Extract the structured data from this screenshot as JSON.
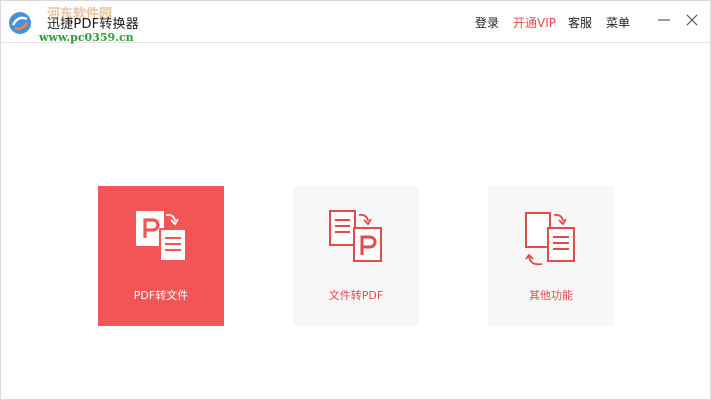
{
  "app": {
    "title": "迅捷PDF转换器",
    "watermark": "河东软件园",
    "watermark_url": "www.pc0359.cn"
  },
  "menu": {
    "login": "登录",
    "vip": "开通VIP",
    "service": "客服",
    "menu": "菜单"
  },
  "cards": [
    {
      "label": "PDF转文件",
      "icon": "pdf-to-file-icon",
      "active": true
    },
    {
      "label": "文件转PDF",
      "icon": "file-to-pdf-icon",
      "active": false
    },
    {
      "label": "其他功能",
      "icon": "other-functions-icon",
      "active": false
    }
  ],
  "colors": {
    "accent": "#f25555",
    "card_bg": "#f7f7f7",
    "vip_text": "#e84c4c"
  }
}
